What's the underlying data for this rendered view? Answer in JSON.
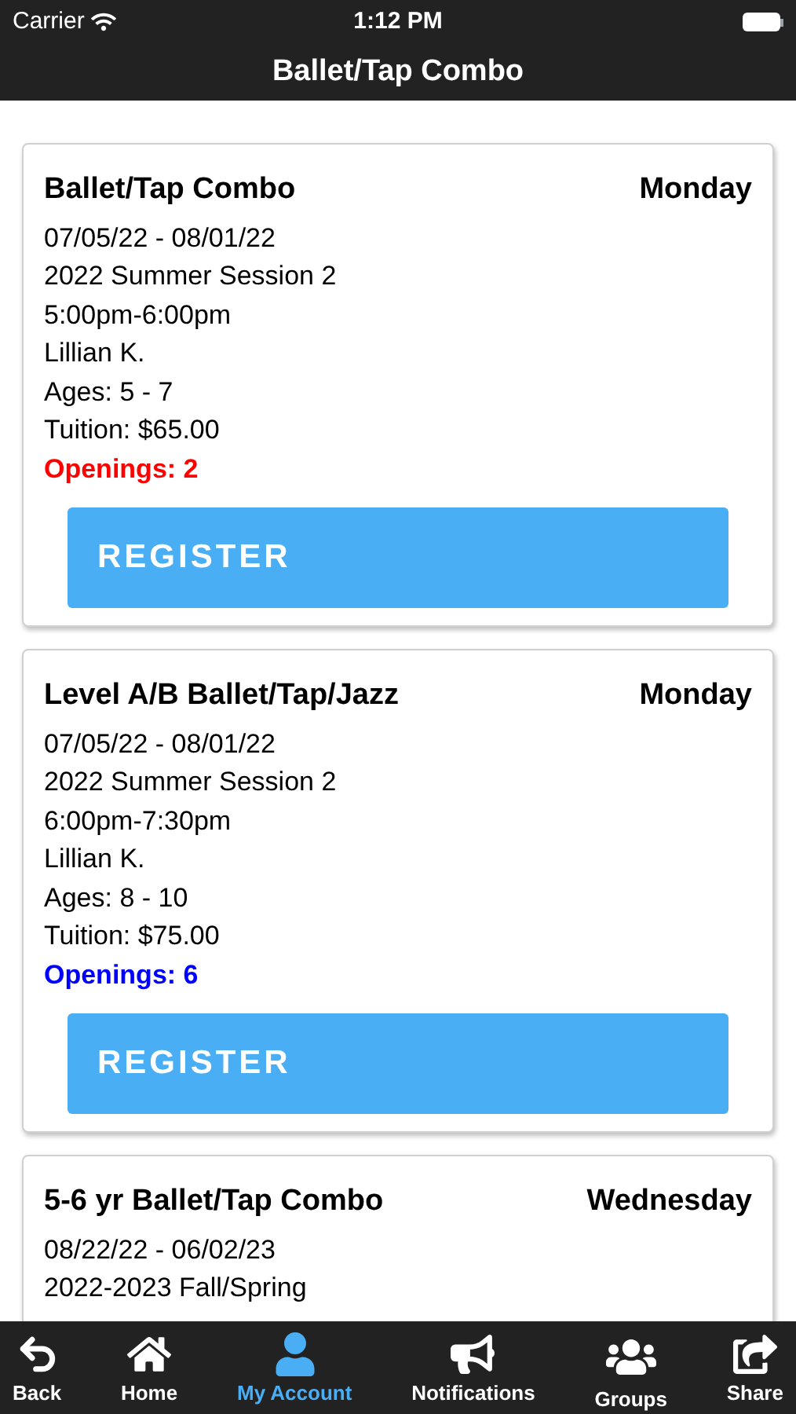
{
  "status_bar": {
    "carrier": "Carrier",
    "time": "1:12 PM"
  },
  "nav_bar": {
    "title": "Ballet/Tap Combo"
  },
  "classes": [
    {
      "name": "Ballet/Tap Combo",
      "day": "Monday",
      "lines": [
        "07/05/22 - 08/01/22",
        "2022 Summer Session 2",
        "5:00pm-6:00pm",
        "Lillian K.",
        "Ages: 5 - 7",
        "Tuition: $65.00"
      ],
      "openings": {
        "text": "Openings: 2",
        "color": "#ff0000"
      },
      "button": "REGISTER"
    },
    {
      "name": "Level A/B Ballet/Tap/Jazz",
      "day": "Monday",
      "lines": [
        "07/05/22 - 08/01/22",
        "2022 Summer Session 2",
        "6:00pm-7:30pm",
        "Lillian K.",
        "Ages: 8 - 10",
        "Tuition: $75.00"
      ],
      "openings": {
        "text": "Openings: 6",
        "color": "#0000ff"
      },
      "button": "REGISTER"
    },
    {
      "name": "5-6 yr Ballet/Tap Combo",
      "day": "Wednesday",
      "lines": [
        "08/22/22 - 06/02/23",
        "2022-2023 Fall/Spring"
      ]
    }
  ],
  "tab_bar": [
    {
      "kind": "back",
      "label": "Back",
      "selected": false
    },
    {
      "kind": "home",
      "label": "Home",
      "selected": false
    },
    {
      "kind": "account",
      "label": "My Account",
      "selected": true
    },
    {
      "kind": "notifications",
      "label": "Notifications",
      "selected": false
    },
    {
      "kind": "groups",
      "label": "Groups",
      "selected": false
    },
    {
      "kind": "share",
      "label": "Share",
      "selected": false
    }
  ]
}
